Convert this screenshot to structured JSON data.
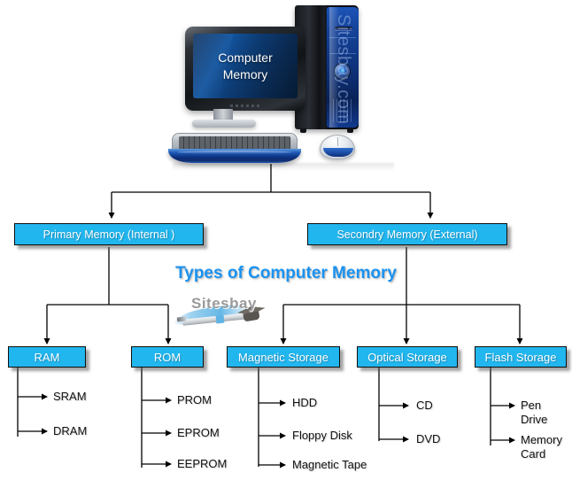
{
  "illustration": {
    "screen_line1": "Computer",
    "screen_line2": "Memory",
    "tower_watermark": "Sitesbay.com",
    "monitor_icon": "monitor-icon",
    "tower_icon": "computer-tower-icon",
    "keyboard_icon": "keyboard-icon",
    "mouse_icon": "mouse-icon"
  },
  "watermark": {
    "brand": "Sitesbay",
    "logo_icon": "graduation-cap-pen-logo-icon"
  },
  "title": "Types of Computer Memory",
  "colors": {
    "node_fill": "#22b6ef",
    "node_border": "#0e0e0e",
    "node_text": "#ffffff",
    "title_text": "#1b92f0",
    "leaf_text": "#111111",
    "connector": "#000000",
    "background": "#ffffff"
  },
  "diagram": {
    "root": "Computer Memory",
    "level2": [
      {
        "id": "primary",
        "label": "Primary Memory (Internal )"
      },
      {
        "id": "secondary",
        "label": "Secondry Memory (External)"
      }
    ],
    "level3": [
      {
        "id": "ram",
        "label": "RAM",
        "parent": "primary"
      },
      {
        "id": "rom",
        "label": "ROM",
        "parent": "primary"
      },
      {
        "id": "magnetic",
        "label": "Magnetic Storage",
        "parent": "secondary"
      },
      {
        "id": "optical",
        "label": "Optical Storage",
        "parent": "secondary"
      },
      {
        "id": "flash",
        "label": "Flash Storage",
        "parent": "secondary"
      }
    ],
    "leaves": {
      "ram": [
        "SRAM",
        "DRAM"
      ],
      "rom": [
        "PROM",
        "EPROM",
        "EEPROM"
      ],
      "magnetic": [
        "HDD",
        "Floppy Disk",
        "Magnetic Tape"
      ],
      "optical": [
        "CD",
        "DVD"
      ],
      "flash": [
        "Pen Drive",
        "Memory Card"
      ]
    }
  }
}
